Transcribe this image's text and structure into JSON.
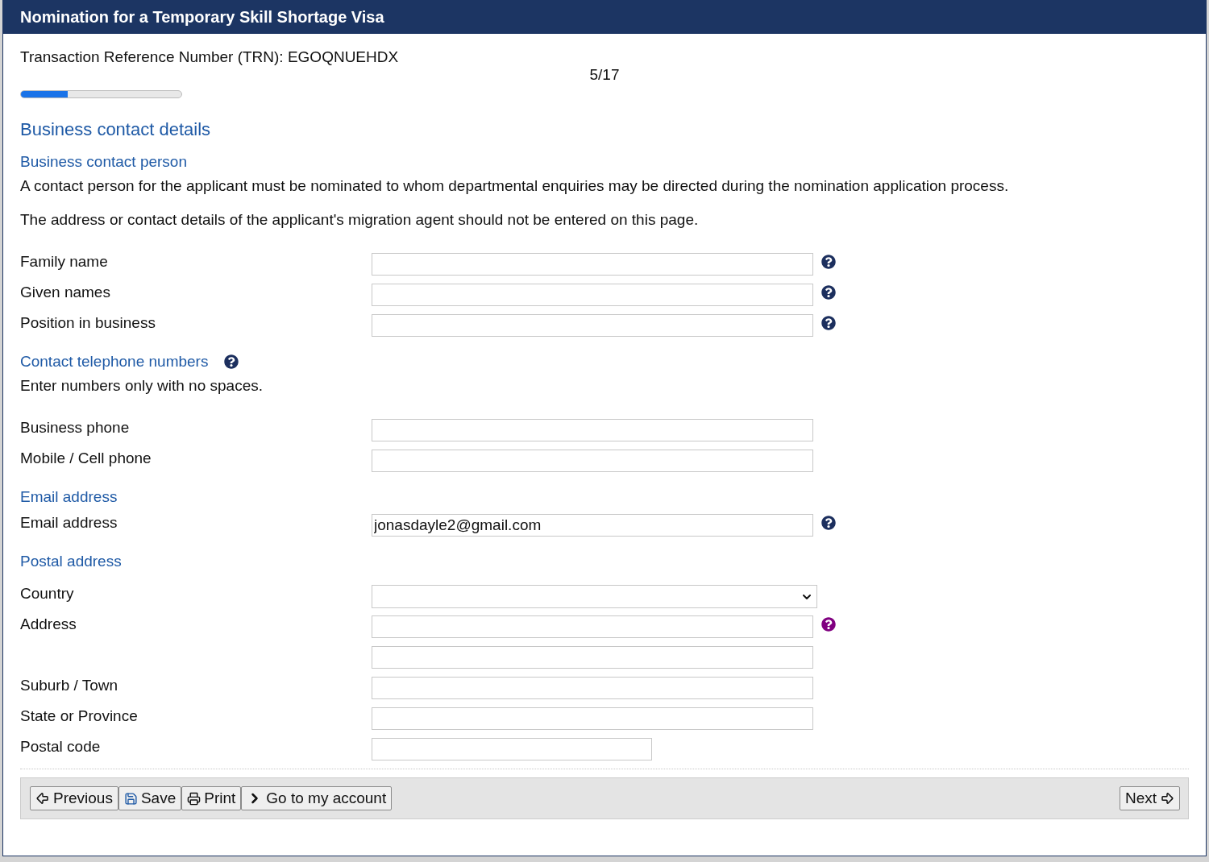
{
  "window": {
    "title": "Nomination for a Temporary Skill Shortage Visa"
  },
  "trn": "Transaction Reference Number (TRN): EGOQNUEHDX",
  "progress": {
    "label": "5/17",
    "level": 0.29
  },
  "page_title": "Business contact details",
  "sections": [
    {
      "heading": "Business contact person",
      "notes": [
        "A contact person for the applicant must be nominated to whom departmental enquiries may be directed during the nomination application process.",
        "The address or contact details of the applicant's migration agent should not be entered on this page."
      ],
      "fields": [
        {
          "label": "Family name",
          "kind": "text",
          "help": {
            "color": "#1c2f5e"
          }
        },
        {
          "label": "Given names",
          "kind": "text",
          "help": {
            "color": "#1c2f5e"
          }
        },
        {
          "label": "Position in business",
          "kind": "text",
          "help": {
            "color": "#1c2f5e"
          }
        }
      ]
    },
    {
      "heading": "Contact telephone numbers",
      "heading_help": {
        "color": "#1c2f5e"
      },
      "notes": [
        "Enter numbers only with no spaces."
      ],
      "fields": [
        {
          "label": "Business phone",
          "kind": "text"
        },
        {
          "label": "Mobile / Cell phone",
          "kind": "text"
        }
      ]
    },
    {
      "heading": "Email address",
      "fields": [
        {
          "label": "Email address",
          "kind": "text",
          "value": "jonasdayle2@gmail.com",
          "help": {
            "color": "#1c2f5e"
          }
        }
      ]
    },
    {
      "heading": "Postal address",
      "fields": [
        {
          "label": "Country",
          "kind": "select"
        },
        {
          "label": "Address",
          "kind": "text",
          "help": {
            "color": "#800080"
          }
        },
        {
          "kind": "text"
        },
        {
          "label": "Suburb / Town",
          "kind": "text"
        },
        {
          "label": "State or Province",
          "kind": "text"
        },
        {
          "label": "Postal code",
          "kind": "short"
        }
      ]
    }
  ],
  "buttons": [
    {
      "label": "Previous",
      "kind": "previous"
    },
    {
      "label": "Save",
      "kind": "save"
    },
    {
      "label": "Print",
      "kind": "print"
    },
    {
      "label": "Go to my account",
      "kind": "account"
    }
  ],
  "next_button": {
    "label": "Next",
    "kind": "next"
  }
}
